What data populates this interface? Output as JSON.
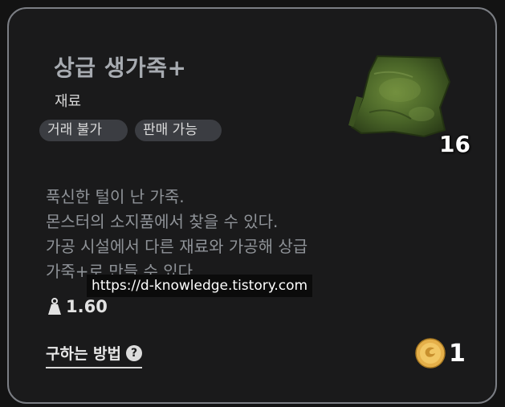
{
  "item": {
    "name": "상급 생가죽+",
    "category": "재료",
    "tags": [
      "거래 불가",
      "판매 가능"
    ],
    "icon": "leather-hide-icon",
    "count": "16",
    "description_lines": [
      "푹신한 털이 난 가죽.",
      "몬스터의 소지품에서 찾을 수 있다.",
      "가공 시설에서 다른 재료와 가공해 상급",
      "가죽+로 만들 수 있다."
    ],
    "weight": "1.60",
    "acquire_label": "구하는 방법",
    "price": "1"
  },
  "watermark": "https://d-knowledge.tistory.com",
  "colors": {
    "card_bg": "#1a1a1b",
    "border": "#7b7e84",
    "title": "#a7abb1",
    "tag_bg": "#3b3d42",
    "description": "#8f9398",
    "coin": "#e5b04a"
  }
}
